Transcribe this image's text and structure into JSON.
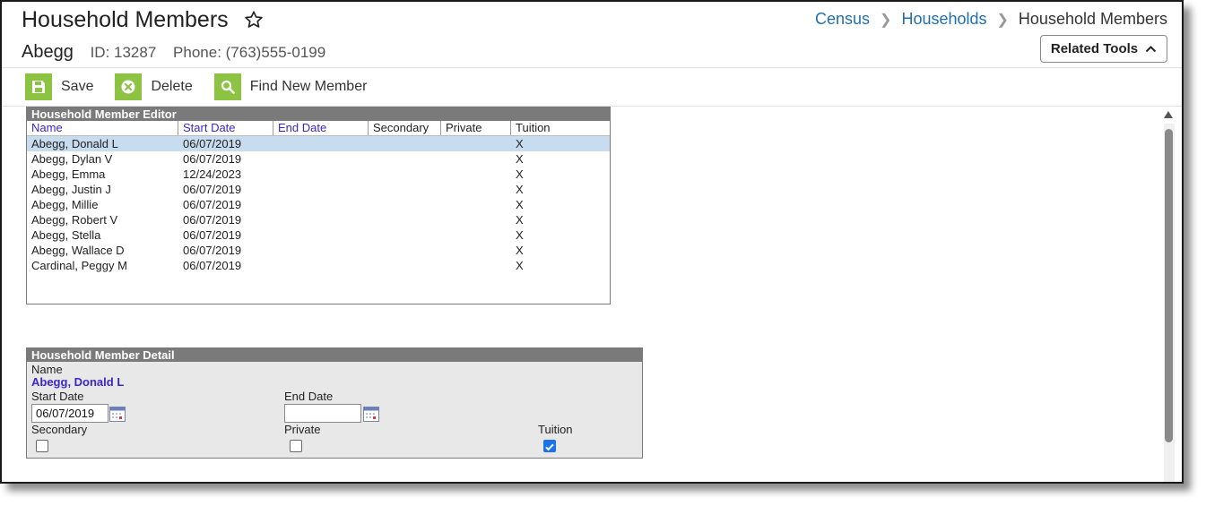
{
  "header": {
    "title": "Household Members",
    "breadcrumb": [
      {
        "label": "Census"
      },
      {
        "label": "Households"
      },
      {
        "label": "Household Members"
      }
    ],
    "household_name": "Abegg",
    "id_text": "ID: 13287",
    "phone_text": "Phone: (763)555-0199",
    "related_tools_label": "Related Tools"
  },
  "toolbar": {
    "save_label": "Save",
    "delete_label": "Delete",
    "find_label": "Find New Member",
    "accent": "#8dc342"
  },
  "editor": {
    "title": "Household Member Editor",
    "columns": [
      "Name",
      "Start Date",
      "End Date",
      "Secondary",
      "Private",
      "Tuition"
    ],
    "rows": [
      {
        "name": "Abegg, Donald L",
        "start": "06/07/2019",
        "end": "",
        "secondary": "",
        "private": "",
        "tuition": "X"
      },
      {
        "name": "Abegg, Dylan V",
        "start": "06/07/2019",
        "end": "",
        "secondary": "",
        "private": "",
        "tuition": "X"
      },
      {
        "name": "Abegg, Emma",
        "start": "12/24/2023",
        "end": "",
        "secondary": "",
        "private": "",
        "tuition": "X"
      },
      {
        "name": "Abegg, Justin J",
        "start": "06/07/2019",
        "end": "",
        "secondary": "",
        "private": "",
        "tuition": "X"
      },
      {
        "name": "Abegg, Millie",
        "start": "06/07/2019",
        "end": "",
        "secondary": "",
        "private": "",
        "tuition": "X"
      },
      {
        "name": "Abegg, Robert V",
        "start": "06/07/2019",
        "end": "",
        "secondary": "",
        "private": "",
        "tuition": "X"
      },
      {
        "name": "Abegg, Stella",
        "start": "06/07/2019",
        "end": "",
        "secondary": "",
        "private": "",
        "tuition": "X"
      },
      {
        "name": "Abegg, Wallace D",
        "start": "06/07/2019",
        "end": "",
        "secondary": "",
        "private": "",
        "tuition": "X"
      },
      {
        "name": "Cardinal, Peggy M",
        "start": "06/07/2019",
        "end": "",
        "secondary": "",
        "private": "",
        "tuition": "X"
      }
    ],
    "selected_row": 0
  },
  "detail": {
    "title": "Household Member Detail",
    "name_label": "Name",
    "name_value": "Abegg, Donald L",
    "start_label": "Start Date",
    "start_value": "06/07/2019",
    "end_label": "End Date",
    "end_value": "",
    "secondary_label": "Secondary",
    "secondary_checked": false,
    "private_label": "Private",
    "private_checked": false,
    "tuition_label": "Tuition",
    "tuition_checked": true
  }
}
